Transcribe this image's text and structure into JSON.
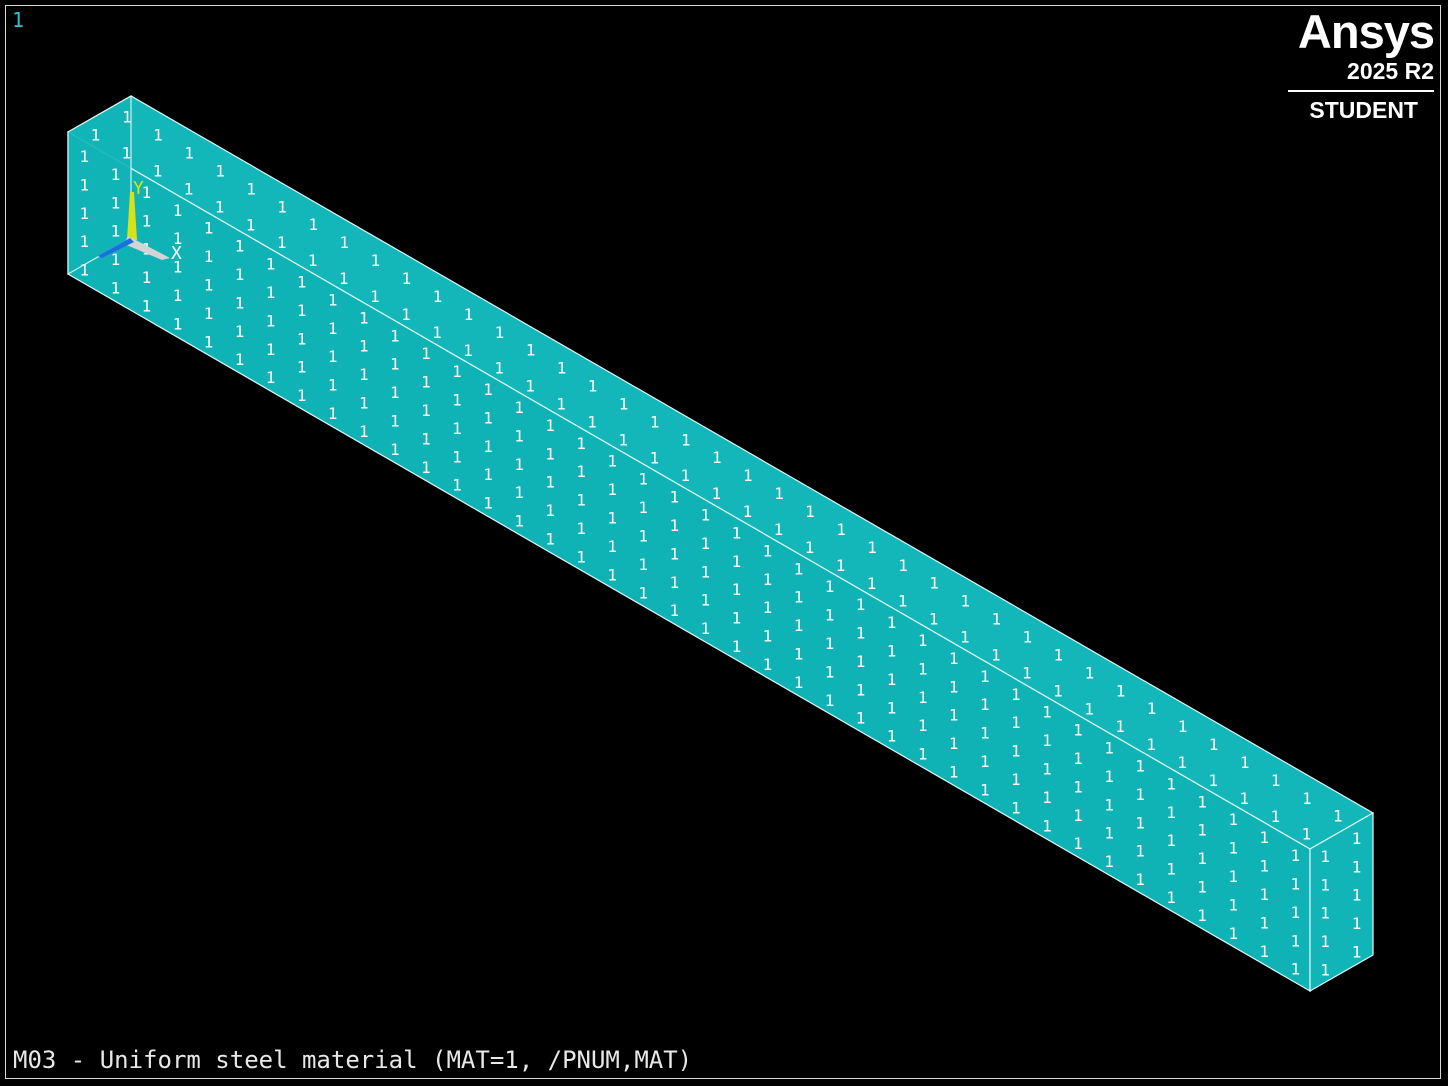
{
  "window": {
    "number": "1"
  },
  "logo": {
    "brand": "Ansys",
    "version": "2025 R2",
    "edition": "STUDENT"
  },
  "caption": "M03 - Uniform steel material (MAT=1, /PNUM,MAT)",
  "model": {
    "element_label": "1",
    "fill_color": "#12b6b8",
    "edge_color": "#dff8f8"
  },
  "triad": {
    "x_label": "X",
    "y_label": "Y",
    "x_color": "#ffffff",
    "y_color": "#d6e21a",
    "z_color": "#1c6fe0"
  }
}
